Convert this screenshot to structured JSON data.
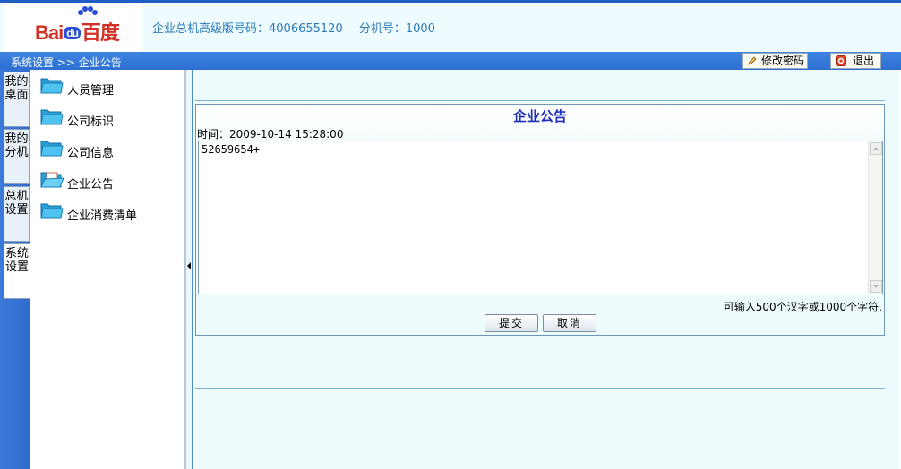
{
  "header": {
    "logo": {
      "bai": "Bai",
      "du": "du",
      "cn": "百度",
      "brand_colors": [
        "#d22f25",
        "#2a4fd6"
      ]
    },
    "hotline_label": "企业总机高级版号码：4006655120",
    "extension_label": "分机号：1000"
  },
  "navbar": {
    "breadcrumb": "系统设置 >> 企业公告",
    "change_password": "修改密码",
    "logout": "退出"
  },
  "left_tabs": [
    {
      "label": "我的桌面",
      "active": false
    },
    {
      "label": "我的分机",
      "active": false
    },
    {
      "label": "总机设置",
      "active": false
    },
    {
      "label": "系统设置",
      "active": true
    }
  ],
  "sidebar": {
    "items": [
      {
        "label": "人员管理",
        "icon": "folder-icon"
      },
      {
        "label": "公司标识",
        "icon": "folder-icon"
      },
      {
        "label": "公司信息",
        "icon": "folder-icon"
      },
      {
        "label": "企业公告",
        "icon": "folder-open-icon"
      },
      {
        "label": "企业消费清单",
        "icon": "folder-icon"
      }
    ]
  },
  "announcement": {
    "title": "企业公告",
    "time_label": "时间：2009-10-14 15:28:00",
    "content": "52659654+",
    "hint": "可输入500个汉字或1000个字符.",
    "submit": "提交",
    "cancel": "取消"
  },
  "colors": {
    "accent": "#2d6fd2",
    "title": "#1f2fbf",
    "header_text": "#2e7ab8",
    "panel_bg": "#eefbfc"
  }
}
